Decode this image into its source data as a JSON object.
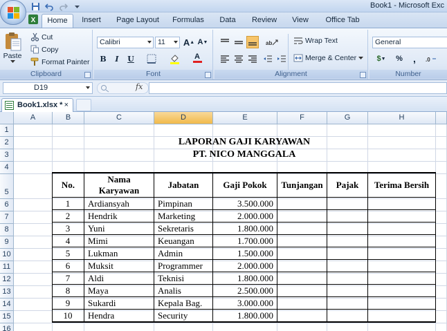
{
  "window": {
    "title": "Book1 - Microsoft Exc"
  },
  "ribbon_tabs": [
    {
      "label": "Home",
      "active": true
    },
    {
      "label": "Insert"
    },
    {
      "label": "Page Layout"
    },
    {
      "label": "Formulas"
    },
    {
      "label": "Data"
    },
    {
      "label": "Review"
    },
    {
      "label": "View"
    },
    {
      "label": "Office Tab"
    }
  ],
  "clipboard": {
    "paste": "Paste",
    "cut": "Cut",
    "copy": "Copy",
    "format_painter": "Format Painter",
    "group": "Clipboard"
  },
  "font": {
    "name": "Calibri",
    "size": "11",
    "bold": "B",
    "italic": "I",
    "underline": "U",
    "grow": "A",
    "shrink": "A",
    "color_letter": "A",
    "group": "Font"
  },
  "alignment": {
    "wrap_text": "Wrap Text",
    "merge_center": "Merge & Center",
    "group": "Alignment"
  },
  "number": {
    "format": "General",
    "percent": "%",
    "comma": ",",
    "group": "Number",
    "dollar": "$"
  },
  "formula_bar": {
    "name_box": "D19",
    "fx": "fx",
    "formula": ""
  },
  "workbook_tab": {
    "name": "Book1.xlsx *",
    "close": "×"
  },
  "grid": {
    "columns": [
      "A",
      "B",
      "C",
      "D",
      "E",
      "F",
      "G",
      "H",
      ""
    ],
    "selected_column": "D",
    "rows": [
      "1",
      "2",
      "3",
      "4",
      "5",
      "6",
      "7",
      "8",
      "9",
      "10",
      "11",
      "12",
      "13",
      "14",
      "15",
      "16"
    ],
    "selected_row": "19"
  },
  "report": {
    "title": "LAPORAN GAJI KARYAWAN",
    "subtitle": "PT. NICO MANGGALA",
    "headers": {
      "no": "No.",
      "nama_line1": "Nama",
      "nama_line2": "Karyawan",
      "jabatan": "Jabatan",
      "gaji_pokok": "Gaji Pokok",
      "tunjangan": "Tunjangan",
      "pajak": "Pajak",
      "terima_bersih": "Terima Bersih"
    },
    "rows": [
      {
        "no": "1",
        "nama": "Ardiansyah",
        "jabatan": "Pimpinan",
        "gaji": "3.500.000"
      },
      {
        "no": "2",
        "nama": "Hendrik",
        "jabatan": "Marketing",
        "gaji": "2.000.000"
      },
      {
        "no": "3",
        "nama": "Yuni",
        "jabatan": "Sekretaris",
        "gaji": "1.800.000"
      },
      {
        "no": "4",
        "nama": "Mimi",
        "jabatan": "Keuangan",
        "gaji": "1.700.000"
      },
      {
        "no": "5",
        "nama": "Lukman",
        "jabatan": "Admin",
        "gaji": "1.500.000"
      },
      {
        "no": "6",
        "nama": "Muksit",
        "jabatan": "Programmer",
        "gaji": "2.000.000"
      },
      {
        "no": "7",
        "nama": "Aldi",
        "jabatan": "Teknisi",
        "gaji": "1.800.000"
      },
      {
        "no": "8",
        "nama": "Maya",
        "jabatan": "Analis",
        "gaji": "2.500.000"
      },
      {
        "no": "9",
        "nama": "Sukardi",
        "jabatan": "Kepala Bag.",
        "gaji": "3.000.000"
      },
      {
        "no": "10",
        "nama": "Hendra",
        "jabatan": "Security",
        "gaji": "1.800.000"
      }
    ]
  },
  "colors": {
    "ribbon_bg": "#dfe9f6",
    "selected_header": "#f1b94b",
    "grid_line": "#d0d7e5"
  }
}
